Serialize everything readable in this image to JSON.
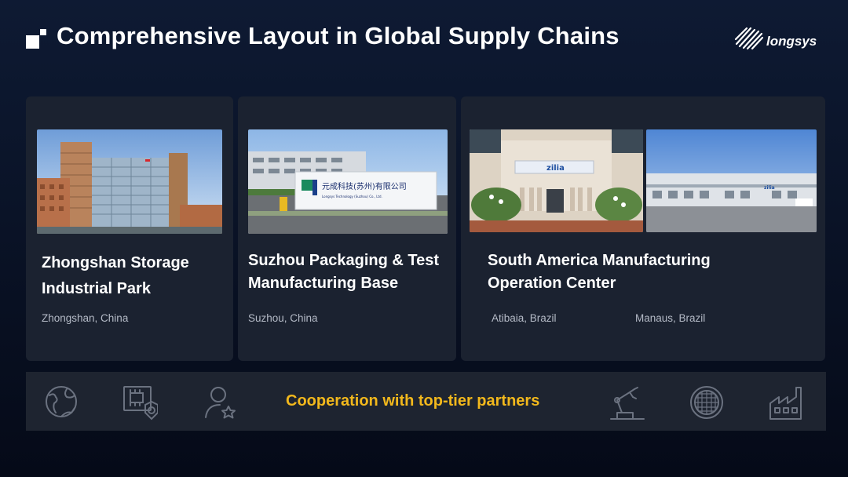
{
  "header": {
    "title": "Comprehensive Layout in Global Supply Chains",
    "brand": "longsys"
  },
  "cards": [
    {
      "title_line1": "Zhongshan Storage",
      "title_line2": "Industrial Park",
      "locations": [
        "Zhongshan, China"
      ]
    },
    {
      "title_line1": "Suzhou Packaging & Test",
      "title_line2": "Manufacturing Base",
      "locations": [
        "Suzhou, China"
      ],
      "sign_text": "元成科技(苏州)有限公司",
      "sign_subtext": "Longsys Technology (Suzhou) Co., Ltd."
    },
    {
      "title_line1": "South America Manufacturing",
      "title_line2": "Operation Center",
      "locations": [
        "Atibaia, Brazil",
        "Manaus, Brazil"
      ],
      "sign_text": "zilia"
    }
  ],
  "bottom_bar": {
    "text": "Cooperation with top-tier partners",
    "text_color": "#f2b81c",
    "icons": [
      "globe-hand-icon",
      "chip-certificate-icon",
      "user-star-icon",
      "robot-arm-icon",
      "wafer-icon",
      "factory-icon"
    ]
  }
}
